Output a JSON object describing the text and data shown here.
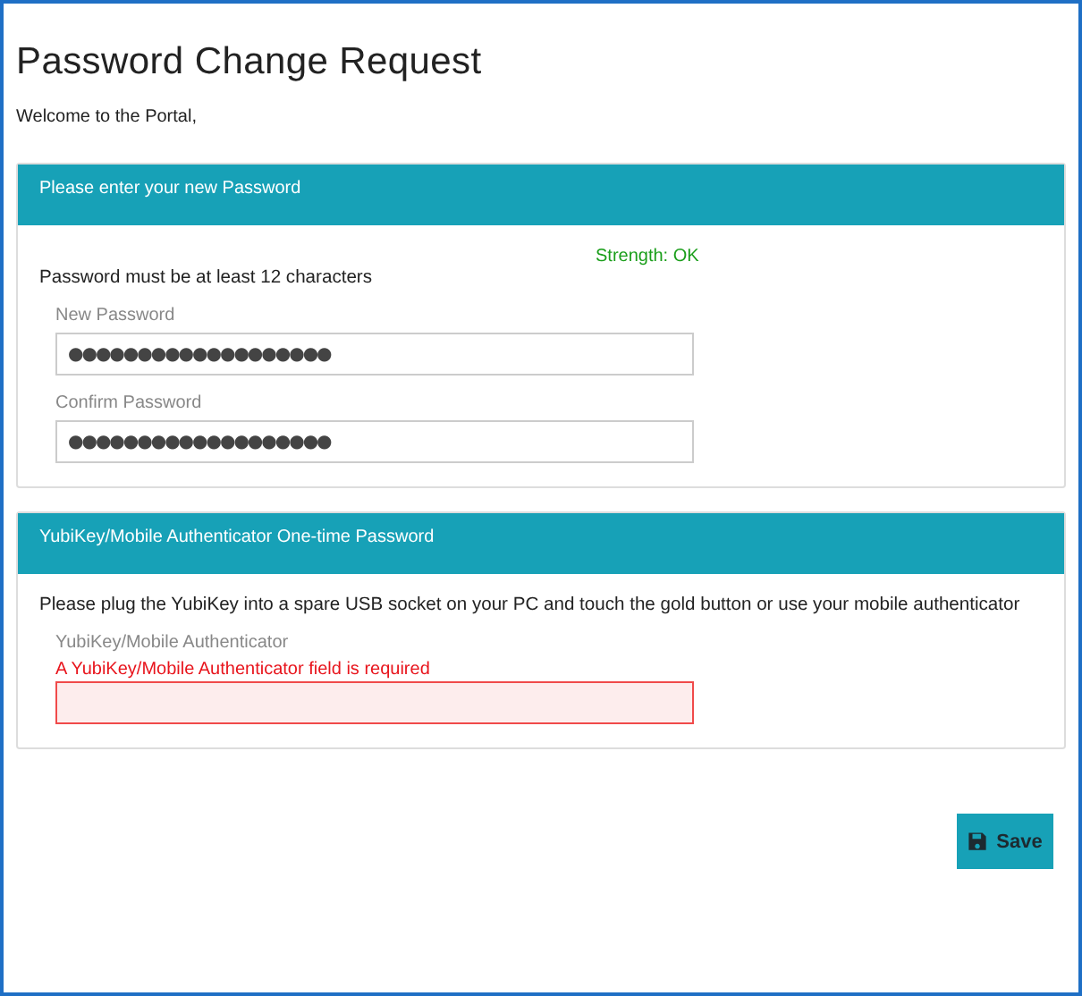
{
  "title": "Password Change Request",
  "welcome": "Welcome to the Portal,",
  "panels": [
    {
      "heading": "Please enter your new Password",
      "strength": "Strength: OK",
      "intro": "Password must be at least 12 characters",
      "fields": [
        {
          "label": "New Password",
          "value": "●●●●●●●●●●●●●●●●●●●",
          "error": false
        },
        {
          "label": "Confirm Password",
          "value": "●●●●●●●●●●●●●●●●●●●",
          "error": false
        }
      ]
    },
    {
      "heading": "YubiKey/Mobile Authenticator One-time Password",
      "intro": "Please plug the YubiKey into a spare USB socket on your PC and touch the gold button or use your mobile authenticator",
      "fields": [
        {
          "label": "YubiKey/Mobile Authenticator",
          "message": "A YubiKey/Mobile Authenticator field is required",
          "error": true
        }
      ]
    }
  ],
  "save_button": "Save"
}
